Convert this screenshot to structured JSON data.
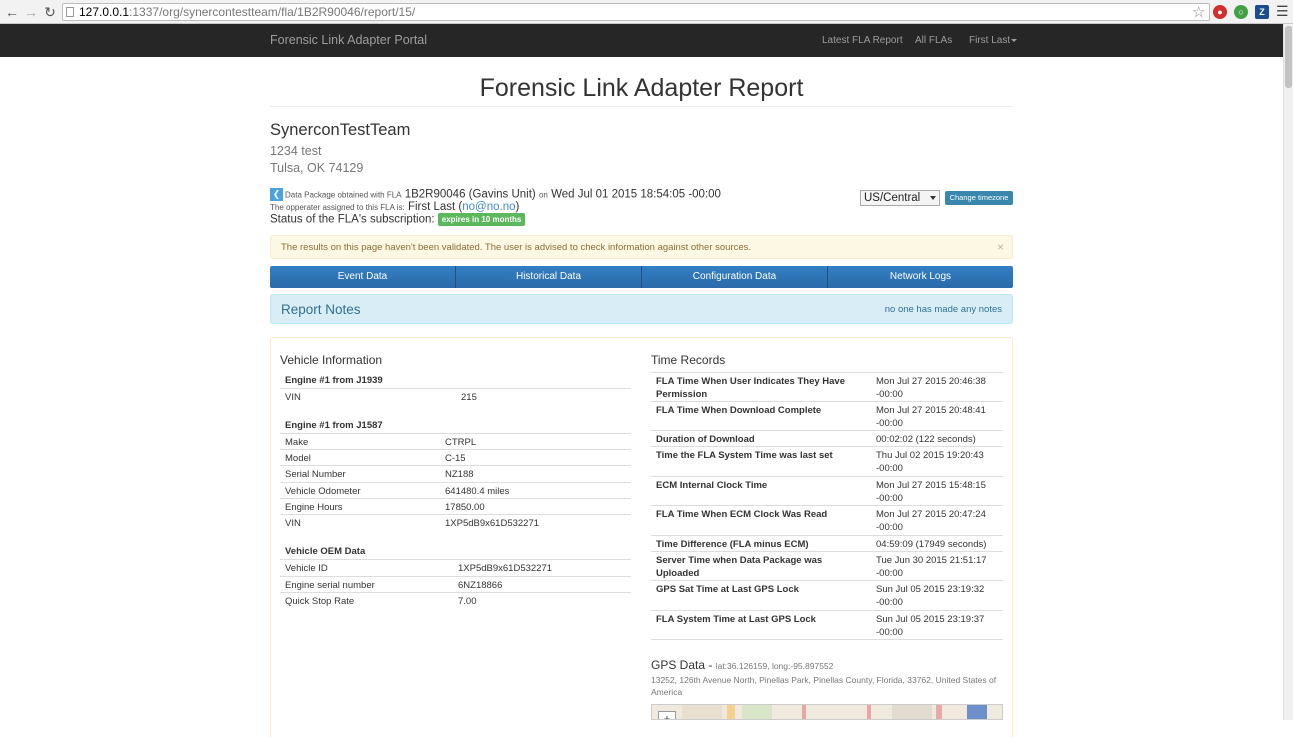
{
  "browser": {
    "url_host": "127.0.0.1",
    "url_path": ":1337/org/synercontestteam/fla/1B2R90046/report/15/"
  },
  "navbar": {
    "brand": "Forensic Link Adapter Portal",
    "links": [
      "Latest FLA Report",
      "All FLAs"
    ],
    "user_menu": "First Last"
  },
  "header": {
    "title": "Forensic Link Adapter Report"
  },
  "org": {
    "name": "SynerconTestTeam",
    "address_line1": "1234 test",
    "address_line2": "Tulsa, OK 74129"
  },
  "package": {
    "prefix": "Data Package obtained with FLA",
    "fla_id": "1B2R90046 (Gavins Unit)",
    "on_label": "on",
    "date": "Wed Jul 01 2015 18:54:05 -00:00",
    "operator_prefix": "The opperater assigned to this FLA is:",
    "operator_name": "First Last (",
    "operator_email": "no@no.no",
    "operator_suffix": ")",
    "status_label": "Status of the FLA's subscription:",
    "status_badge": "expires in 10 months"
  },
  "timezone": {
    "selected": "US/Central",
    "button": "Change timezone"
  },
  "alert": {
    "text": "The results on this page haven't been validated. The user is advised to check information against other sources.",
    "close": "×"
  },
  "tabs": [
    "Event Data",
    "Historical Data",
    "Configuration Data",
    "Network Logs"
  ],
  "notes": {
    "title": "Report Notes",
    "status": "no one has made any notes"
  },
  "vehicle_info": {
    "title": "Vehicle Information",
    "groups": [
      {
        "title": "Engine #1 from J1939",
        "rows": [
          {
            "k": "VIN",
            "v": "215"
          }
        ]
      },
      {
        "title": "Engine #1 from J1587",
        "rows": [
          {
            "k": "Make",
            "v": "CTRPL"
          },
          {
            "k": "Model",
            "v": "C-15"
          },
          {
            "k": "Serial Number",
            "v": "NZ188"
          },
          {
            "k": "Vehicle Odometer",
            "v": "641480.4 miles"
          },
          {
            "k": "Engine Hours",
            "v": "17850.00"
          },
          {
            "k": "VIN",
            "v": "1XP5dB9x61D532271"
          }
        ]
      },
      {
        "title": "Vehicle OEM Data",
        "rows": [
          {
            "k": "Vehicle ID",
            "v": "1XP5dB9x61D532271"
          },
          {
            "k": "Engine serial number",
            "v": "6NZ18866"
          },
          {
            "k": "Quick Stop Rate",
            "v": "7.00"
          }
        ]
      }
    ]
  },
  "time_records": {
    "title": "Time Records",
    "rows": [
      {
        "k": "FLA Time When User Indicates They Have Permission",
        "v": "Mon Jul 27 2015 20:46:38 -00:00"
      },
      {
        "k": "FLA Time When Download Complete",
        "v": "Mon Jul 27 2015 20:48:41 -00:00"
      },
      {
        "k": "Duration of Download",
        "v": "00:02:02 (122 seconds)"
      },
      {
        "k": "Time the FLA System Time was last set",
        "v": "Thu Jul 02 2015 19:20:43 -00:00"
      },
      {
        "k": "ECM Internal Clock Time",
        "v": "Mon Jul 27 2015 15:48:15 -00:00"
      },
      {
        "k": "FLA Time When ECM Clock Was Read",
        "v": "Mon Jul 27 2015 20:47:24 -00:00"
      },
      {
        "k": "Time Difference (FLA minus ECM)",
        "v": "04:59:09 (17949 seconds)"
      },
      {
        "k": "Server Time when Data Package was Uploaded",
        "v": "Tue Jun 30 2015 21:51:17 -00:00"
      },
      {
        "k": "GPS Sat Time at Last GPS Lock",
        "v": "Sun Jul 05 2015 23:19:32 -00:00"
      },
      {
        "k": "FLA System Time at Last GPS Lock",
        "v": "Sun Jul 05 2015 23:19:37 -00:00"
      }
    ]
  },
  "gps": {
    "title": "GPS Data -",
    "latlong": "lat:36.126159, long:-95.897552",
    "address": "13252, 126th Avenue North, Pinellas Park, Pinellas County, Florida, 33762, United States of America",
    "zoom_in": "+"
  }
}
